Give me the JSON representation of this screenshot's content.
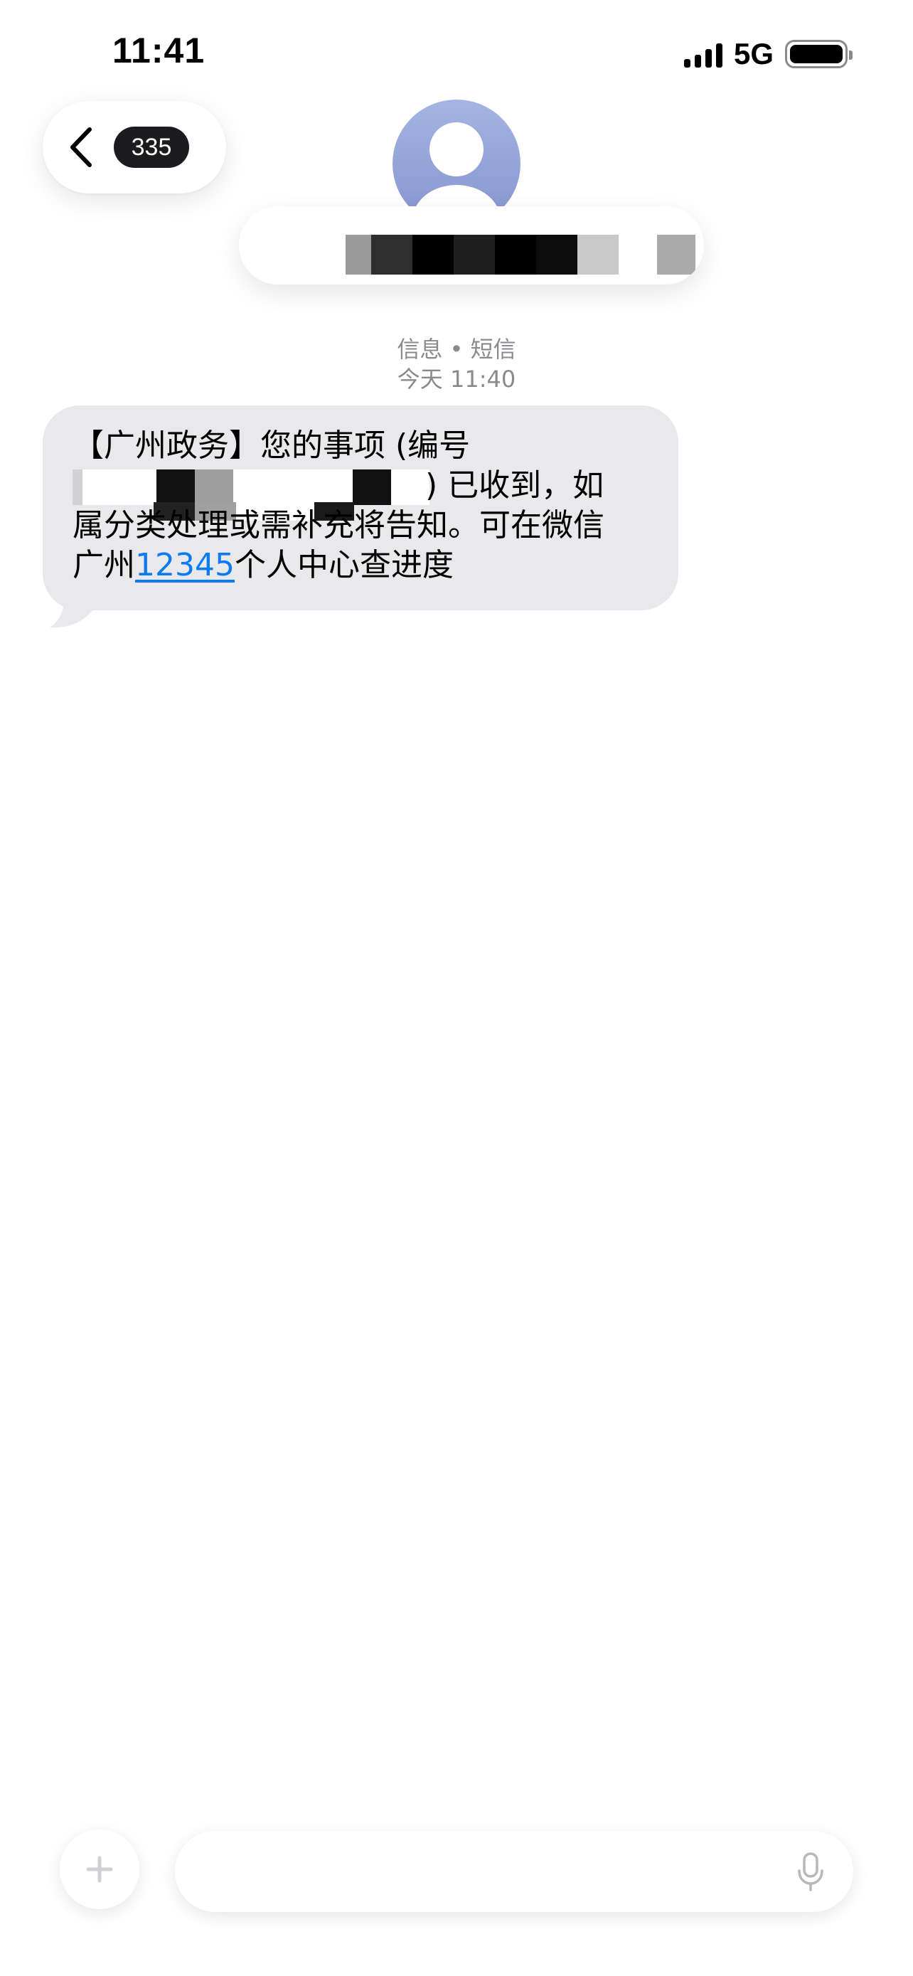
{
  "status_bar": {
    "time": "11:41",
    "network": "5G",
    "icons": [
      "signal-icon",
      "battery-icon"
    ]
  },
  "nav": {
    "back_icon": "chevron-left-icon",
    "unread_count": "335"
  },
  "contact": {
    "avatar_icon": "person-icon",
    "name_redacted": true
  },
  "thread_meta": {
    "service": "信息 • 短信",
    "timestamp": "今天 11:40"
  },
  "message": {
    "line1": "【广州政务】您的事项 (编号",
    "line2": ") 已收到，如",
    "line3": "属分类处理或需补充将告知。可在微信",
    "line4_prefix": "广州",
    "line4_link": "12345",
    "line4_suffix": "个人中心查进度"
  },
  "composer": {
    "plus_icon": "plus-icon",
    "placeholder": "",
    "mic_icon": "microphone-icon"
  },
  "colors": {
    "bubble": "#e9e9eb",
    "link": "#0a7bf5",
    "meta_text": "#8a8a8e"
  }
}
